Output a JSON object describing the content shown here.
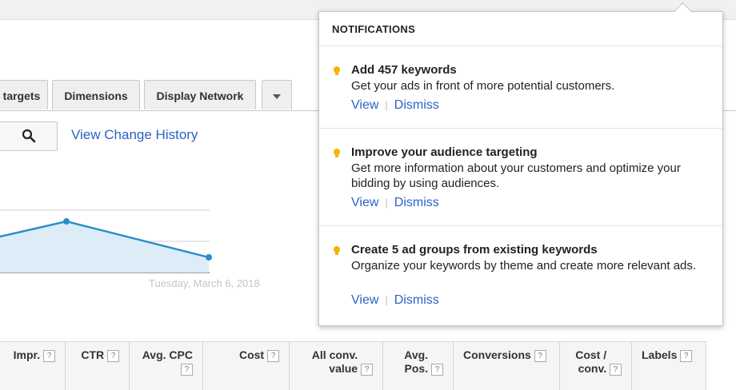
{
  "tabs": [
    {
      "label": "targets"
    },
    {
      "label": "Dimensions"
    },
    {
      "label": "Display Network"
    }
  ],
  "toolbar": {
    "history_link": "View Change History"
  },
  "chart_data": {
    "type": "area",
    "x_label_visible": "Tuesday, March 6, 2018",
    "series": [
      {
        "values": [
          null,
          null,
          null
        ]
      }
    ],
    "grid": true
  },
  "table": {
    "columns": [
      {
        "label": "Impr."
      },
      {
        "label": "CTR"
      },
      {
        "label": "Avg. CPC"
      },
      {
        "label": "Cost"
      },
      {
        "label": "All conv. value"
      },
      {
        "label": "Avg. Pos."
      },
      {
        "label": "Conversions"
      },
      {
        "label": "Cost / conv."
      },
      {
        "label": "Labels"
      }
    ]
  },
  "notifications": {
    "title": "NOTIFICATIONS",
    "items": [
      {
        "title": "Add 457 keywords",
        "desc": "Get your ads in front of more potential customers.",
        "view": "View",
        "dismiss": "Dismiss"
      },
      {
        "title": "Improve your audience targeting",
        "desc": "Get more information about your customers and optimize your bidding by using audiences.",
        "view": "View",
        "dismiss": "Dismiss"
      },
      {
        "title": "Create 5 ad groups from existing keywords",
        "desc": "Organize your keywords by theme and create more relevant ads.",
        "view": "View",
        "dismiss": "Dismiss"
      }
    ]
  },
  "help_glyph": "?"
}
